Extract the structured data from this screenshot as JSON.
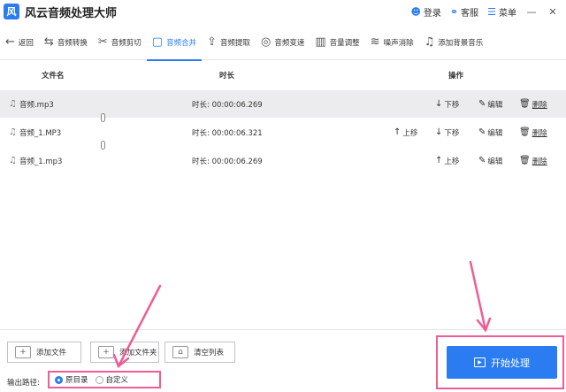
{
  "app": {
    "logo_text": "风",
    "title": "风云音频处理大师"
  },
  "titlebar": {
    "login_label": "登录",
    "service_label": "客服",
    "menu_label": "菜单",
    "minimize_glyph": "—",
    "close_glyph": "✕"
  },
  "toolbar": {
    "items": [
      {
        "label": "返回",
        "icon": "back-arrow-icon",
        "glyph": "←"
      },
      {
        "label": "音频转换",
        "icon": "convert-icon",
        "glyph": "⇆"
      },
      {
        "label": "音频剪切",
        "icon": "scissors-icon",
        "glyph": "✂"
      },
      {
        "label": "音频合并",
        "icon": "merge-icon",
        "glyph": "▢",
        "active": true
      },
      {
        "label": "音频提取",
        "icon": "extract-icon",
        "glyph": "⇪"
      },
      {
        "label": "音频变速",
        "icon": "speed-icon",
        "glyph": "◎"
      },
      {
        "label": "音量调整",
        "icon": "volume-bars-icon",
        "glyph": "▥"
      },
      {
        "label": "噪声消除",
        "icon": "noise-icon",
        "glyph": "≋"
      },
      {
        "label": "添加背景音乐",
        "icon": "music-note-icon",
        "glyph": "♫"
      }
    ]
  },
  "table": {
    "headers": {
      "name": "文件名",
      "duration": "时长",
      "actions": "操作"
    },
    "duration_prefix": "时长:",
    "up_label": "上移",
    "down_label": "下移",
    "edit_label": "编辑",
    "delete_label": "删除",
    "rows": [
      {
        "name": "音频.mp3",
        "duration": "00:00:06.269"
      },
      {
        "name": "音频_1.MP3",
        "duration": "00:00:06.321"
      },
      {
        "name": "音频_1.mp3",
        "duration": "00:00:06.269"
      }
    ]
  },
  "bottom": {
    "add_file_label": "添加文件",
    "add_folder_label": "添加文件夹",
    "clear_list_label": "清空列表",
    "output_path_label": "输出路径:",
    "option_original": "原目录",
    "option_custom": "自定义",
    "start_label": "开始处理"
  },
  "colors": {
    "accent": "#2b7cf0",
    "highlight": "#ef5c96"
  }
}
